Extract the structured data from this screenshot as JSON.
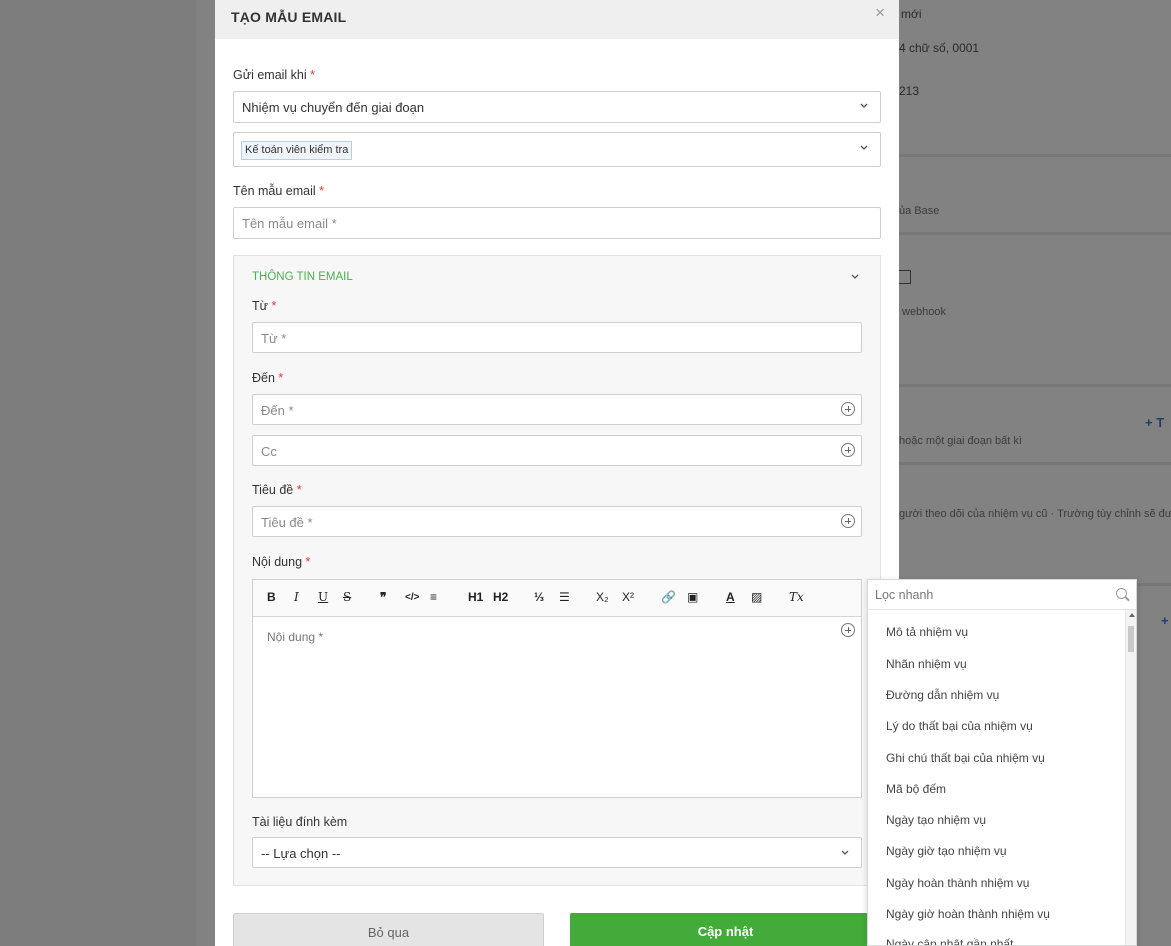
{
  "background": {
    "line1": "mới",
    "line2": "4 chữ số, 0001",
    "line3": "213",
    "line4": "ủa Base",
    "line5": "webhook",
    "line6": "hoặc một giai đoạn bất kì",
    "line7": "gười theo dõi của nhiệm vụ cũ · Trường tùy chỉnh sẽ được",
    "plus1": "+ T",
    "plus2": "+"
  },
  "modal": {
    "title": "TẠO MẪU EMAIL",
    "close": "×",
    "trigger_label": "Gửi email khi",
    "trigger_value": "Nhiệm vụ chuyển đến giai đoạn",
    "stage_tag": "Kế toán viên kiểm tra",
    "template_name_label": "Tên mẫu email",
    "template_name_placeholder": "Tên mẫu email *",
    "required_mark": "*"
  },
  "email_section": {
    "title": "THÔNG TIN EMAIL",
    "from_label": "Từ",
    "from_placeholder": "Từ *",
    "to_label": "Đến",
    "to_placeholder": "Đến *",
    "cc_placeholder": "Cc",
    "subject_label": "Tiêu đề",
    "subject_placeholder": "Tiêu đề *",
    "content_label": "Nội dung",
    "content_placeholder": "Nội dung *",
    "attachment_label": "Tài liệu đính kèm",
    "attachment_value": "-- Lựa chọn --"
  },
  "toolbar": {
    "bold": "B",
    "italic": "I",
    "underline": "U",
    "strike": "S",
    "quote": "❞",
    "code": "</>",
    "align": "≡",
    "h1": "H1",
    "h2": "H2",
    "ol": "⅓",
    "ul": "☰",
    "sub": "X₂",
    "sup": "X²",
    "link": "🔗",
    "image": "▣",
    "color": "A",
    "bg": "▨",
    "clear": "Tx"
  },
  "buttons": {
    "cancel": "Bỏ qua",
    "save": "Cập nhật"
  },
  "popup": {
    "search_placeholder": "Lọc nhanh",
    "options": [
      "Mô tả nhiệm vụ",
      "Nhãn nhiệm vụ",
      "Đường dẫn nhiệm vụ",
      "Lý do thất bại của nhiệm vụ",
      "Ghi chú thất bại của nhiệm vụ",
      "Mã bộ đếm",
      "Ngày tạo nhiệm vụ",
      "Ngày giờ tạo nhiệm vụ",
      "Ngày hoàn thành nhiệm vụ",
      "Ngày giờ hoàn thành nhiệm vụ",
      "Ngày cập nhật gần nhất"
    ]
  }
}
